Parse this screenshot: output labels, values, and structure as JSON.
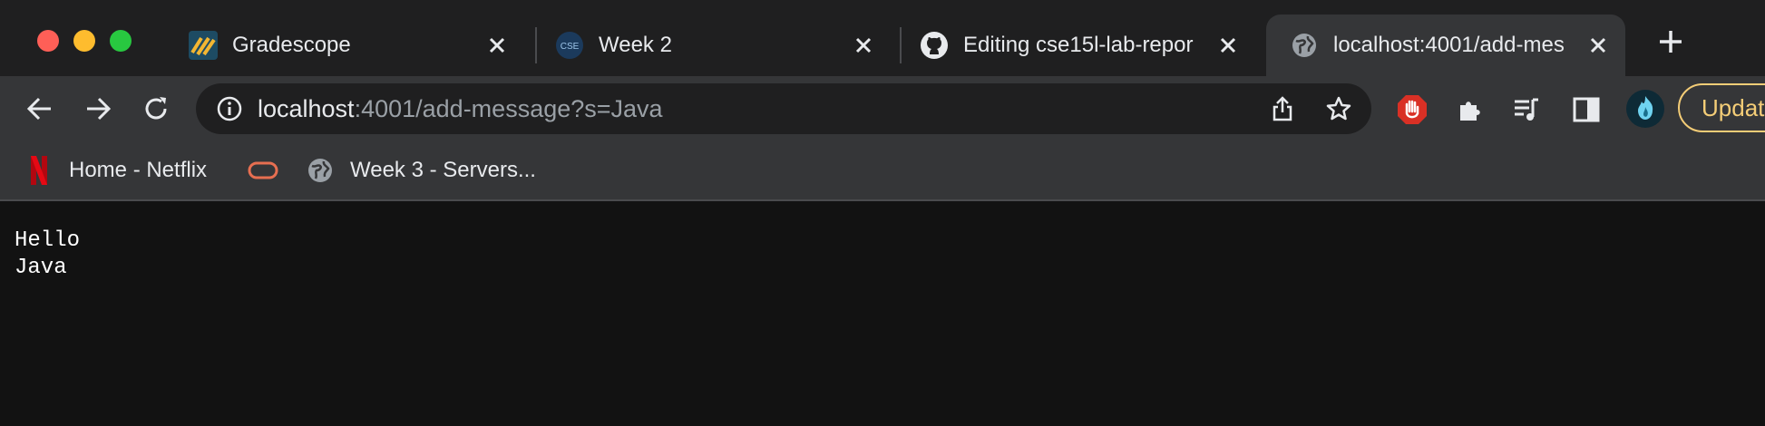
{
  "tabs": [
    {
      "title": "Gradescope",
      "icon": "gradescope-icon"
    },
    {
      "title": "Week 2",
      "icon": "cse-icon",
      "icon_text": "CSE"
    },
    {
      "title": "Editing cse15l-lab-repor",
      "icon": "github-icon"
    },
    {
      "title": "localhost:4001/add-mes",
      "icon": "globe-icon",
      "active": true
    }
  ],
  "toolbar": {
    "url_host": "localhost",
    "url_path": ":4001/add-message?s=Java",
    "update_label": "Updat"
  },
  "bookmarks": [
    {
      "label": "Home - Netflix",
      "icon": "netflix-icon"
    },
    {
      "label": "",
      "icon": "oracle-icon"
    },
    {
      "label": "Week 3 - Servers...",
      "icon": "globe-icon"
    }
  ],
  "page": {
    "lines": [
      "Hello",
      "Java"
    ]
  },
  "colors": {
    "tabstrip": "#1f1f20",
    "toolbar": "#353638",
    "content": "#121212",
    "update_accent": "#f4cd77"
  }
}
